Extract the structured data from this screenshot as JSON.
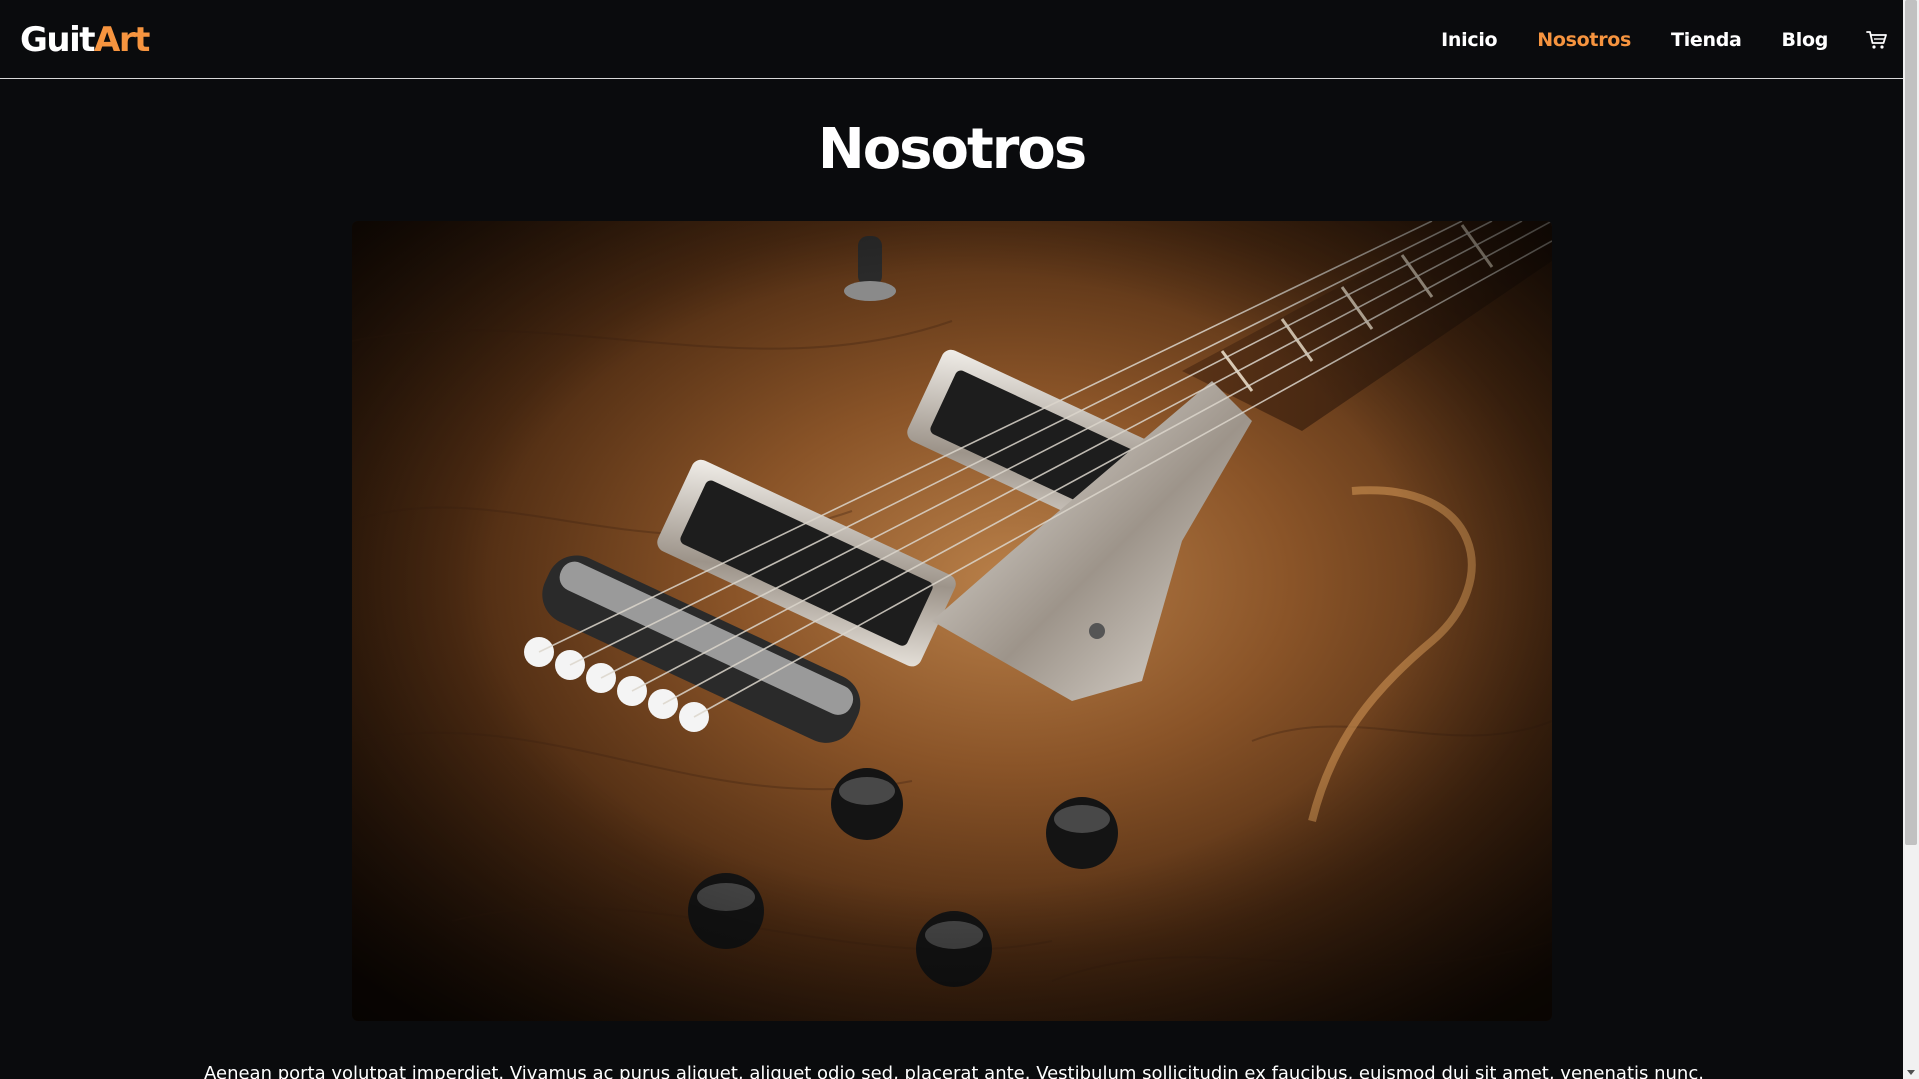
{
  "header": {
    "logo_part1": "Guit",
    "logo_part2": "Art",
    "nav": [
      {
        "label": "Inicio"
      },
      {
        "label": "Nosotros"
      },
      {
        "label": "Tienda"
      },
      {
        "label": "Blog"
      }
    ],
    "active_nav": "Nosotros",
    "cart_icon": "shopping-cart-icon"
  },
  "main": {
    "title": "Nosotros",
    "intro_text": "Aenean porta volutpat imperdiet. Vivamus ac purus aliquet, aliquet odio sed, placerat ante. Vestibulum sollicitudin ex faucibus, euismod dui sit amet, venenatis nunc. Proin vitae"
  },
  "colors": {
    "background": "#0a0b0d",
    "accent": "#f6943f",
    "text": "#ffffff"
  }
}
